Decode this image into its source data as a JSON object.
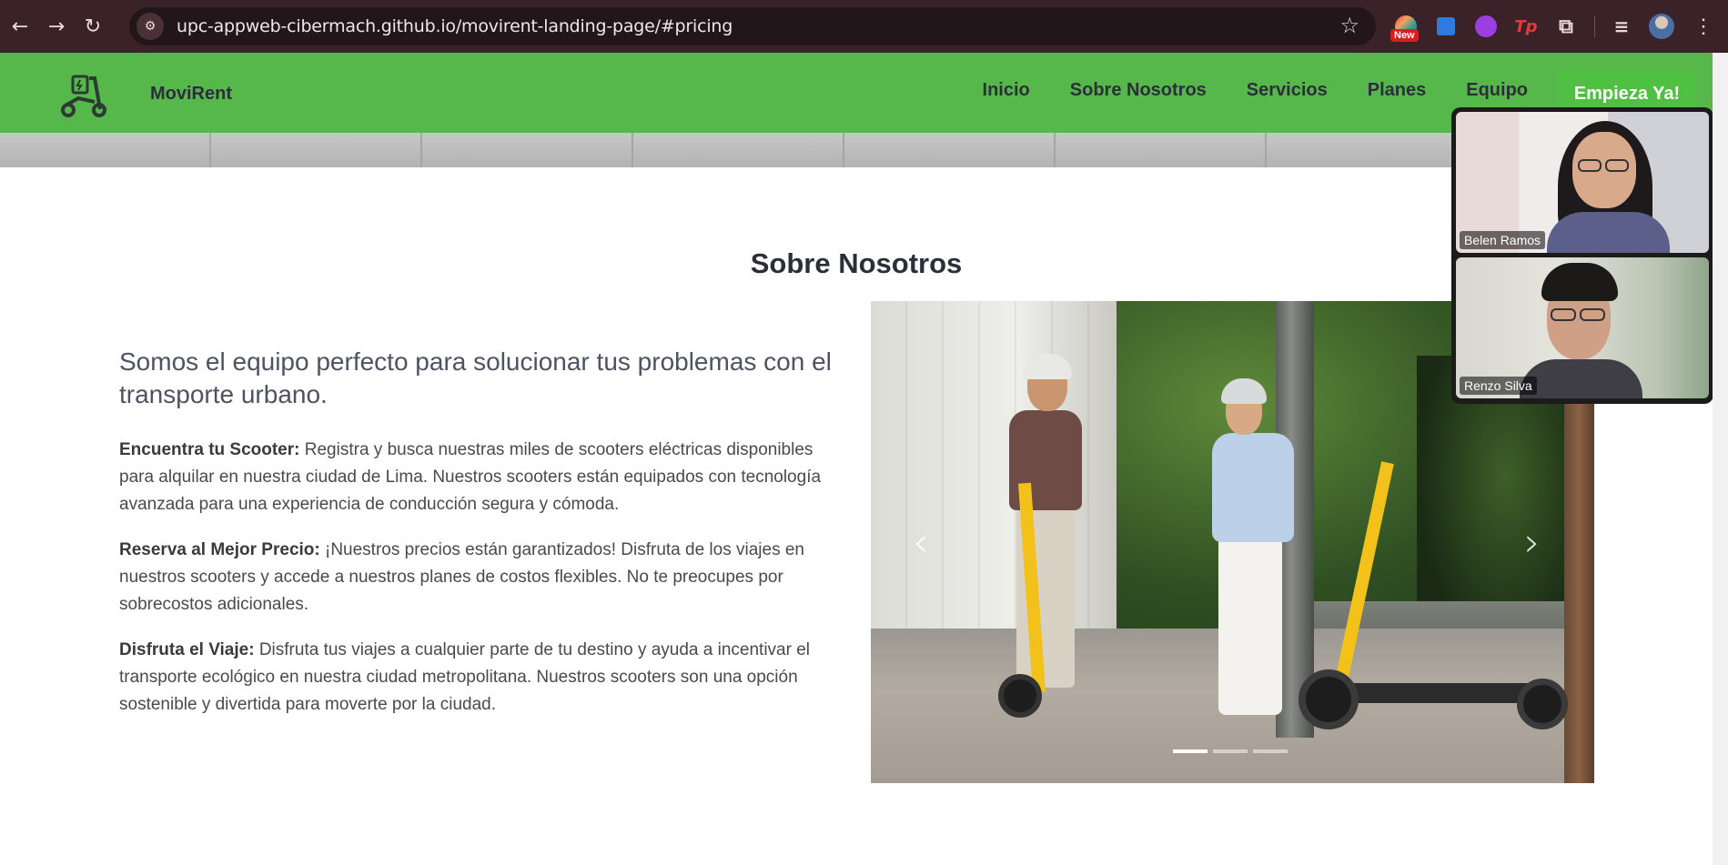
{
  "browser": {
    "url": "upc-appweb-cibermach.github.io/movirent-landing-page/#pricing",
    "extension_badge": "New",
    "extension_tp": "Tp"
  },
  "navbar": {
    "brand": "MoviRent",
    "links": [
      "Inicio",
      "Sobre Nosotros",
      "Servicios",
      "Planes",
      "Equipo"
    ],
    "cta": "Empieza Ya!"
  },
  "about": {
    "title": "Sobre Nosotros",
    "lead": "Somos el equipo perfecto para solucionar tus problemas con el transporte urbano.",
    "items": [
      {
        "heading": "Encuentra tu Scooter:",
        "text": " Registra y busca nuestras miles de scooters eléctricas disponibles para alquilar en nuestra ciudad de Lima. Nuestros scooters están equipados con tecnología avanzada para una experiencia de conducción segura y cómoda."
      },
      {
        "heading": "Reserva al Mejor Precio:",
        "text": " ¡Nuestros precios están garantizados! Disfruta de los viajes en nuestros scooters y accede a nuestros planes de costos flexibles. No te preocupes por sobrecostos adicionales."
      },
      {
        "heading": "Disfruta el Viaje:",
        "text": " Disfruta tus viajes a cualquier parte de tu destino y ayuda a incentivar el transporte ecológico en nuestra ciudad metropolitana. Nuestros scooters son una opción sostenible y divertida para moverte por la ciudad."
      }
    ]
  },
  "carousel": {
    "slide_count": 3,
    "active_index": 0
  },
  "call": {
    "participants": [
      "Belen Ramos",
      "Renzo Silva"
    ]
  },
  "colors": {
    "navbar": "#56b84a",
    "cta": "#4fc041",
    "chrome": "#3b2228"
  }
}
